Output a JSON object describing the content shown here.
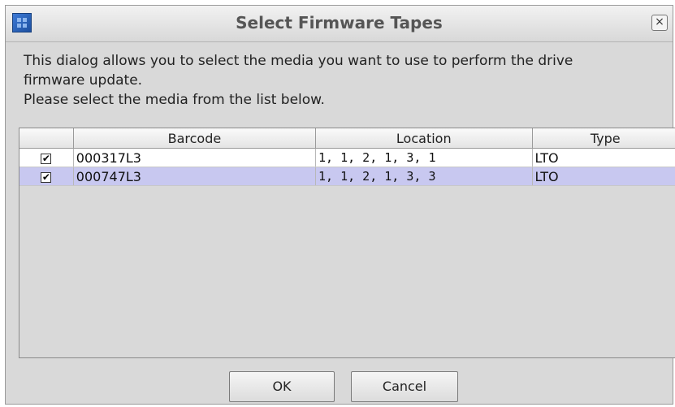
{
  "window": {
    "title": "Select Firmware Tapes",
    "close_glyph": "×",
    "app_icon": "grid-app-icon"
  },
  "description": {
    "line1": "This dialog allows you to select the media you want to use to perform the drive",
    "line2": "firmware update.",
    "line3": "Please select the media from the list below."
  },
  "table": {
    "headers": [
      "",
      "Barcode",
      "Location",
      "Type"
    ],
    "rows": [
      {
        "checked": true,
        "check_glyph": "✔",
        "barcode": "000317L3",
        "location": "1, 1, 2, 1, 3, 1",
        "type": "LTO",
        "selected": false
      },
      {
        "checked": true,
        "check_glyph": "✔",
        "barcode": "000747L3",
        "location": "1, 1, 2, 1, 3, 3",
        "type": "LTO",
        "selected": true
      }
    ]
  },
  "buttons": {
    "ok": "OK",
    "cancel": "Cancel"
  },
  "colors": {
    "selected_row": "#c8c8f0",
    "dialog_bg": "#d9d9d9"
  }
}
